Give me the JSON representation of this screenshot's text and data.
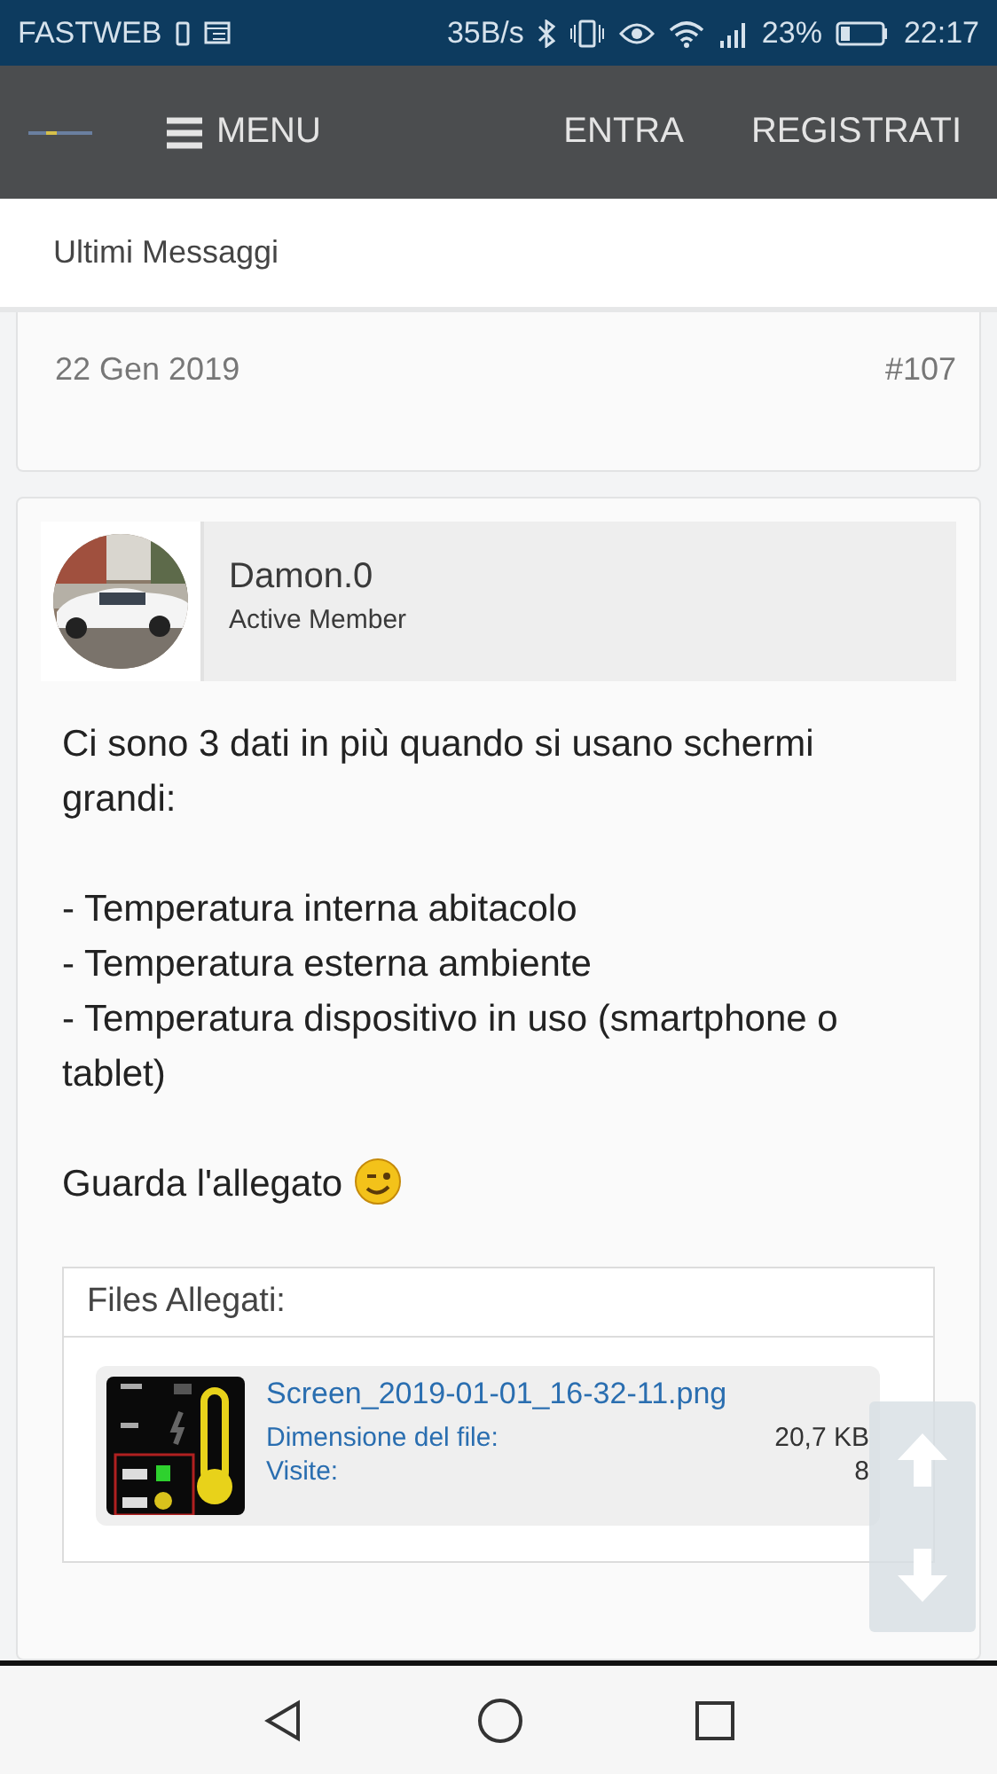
{
  "status_bar": {
    "carrier": "FASTWEB",
    "speed": "35B/s",
    "battery": "23%",
    "time": "22:17"
  },
  "header": {
    "menu_label": "MENU",
    "links": [
      "ENTRA",
      "REGISTRATI"
    ]
  },
  "breadcrumb": "Ultimi Messaggi",
  "previous_post": {
    "date": "22 Gen 2019",
    "number": "#107"
  },
  "post": {
    "author": "Damon.0",
    "role": "Active Member",
    "paragraphs": [
      {
        "lines": [
          "Ci sono 3 dati in più quando si usano schermi grandi:"
        ]
      },
      {
        "lines": [
          "- Temperatura interna abitacolo",
          "- Temperatura esterna ambiente",
          "- Temperatura dispositivo in uso (smartphone o tablet)"
        ]
      },
      {
        "lines": [
          "Guarda l'allegato"
        ],
        "emoji": true
      }
    ],
    "attachments": {
      "title": "Files Allegati:",
      "files": [
        {
          "name": "Screen_2019-01-01_16-32-11.png",
          "size_label": "Dimensione del file:",
          "size": "20,7 KB",
          "views_label": "Visite:",
          "views": "8"
        }
      ]
    }
  }
}
